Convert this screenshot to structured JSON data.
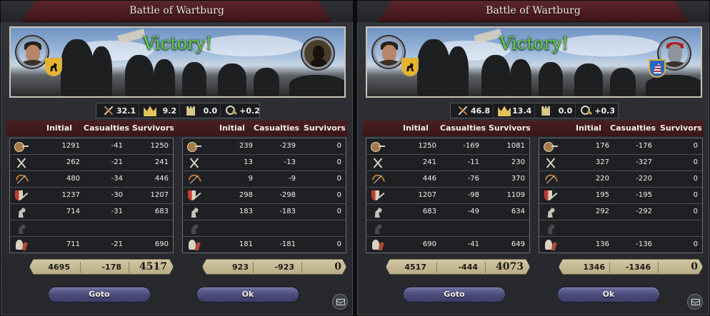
{
  "panels": [
    {
      "title": "Battle of Wartburg",
      "result": "Victory!",
      "left_commander": {
        "portrait": "bearded-noble-portrait",
        "coat_of_arms": "black-beast-on-gold-coa"
      },
      "right_commander": {
        "portrait": "unknown-silhouette-portrait"
      },
      "stats": [
        {
          "icon": "crossed-swords-icon",
          "value": "32.1"
        },
        {
          "icon": "crown-icon",
          "value": "9.2"
        },
        {
          "icon": "tower-icon",
          "value": "0.0"
        },
        {
          "icon": "magnifier-icon",
          "value": "+0.2"
        }
      ],
      "headers": [
        "Initial",
        "Casualties",
        "Survivors"
      ],
      "left_table": {
        "rows": [
          {
            "icon": "light-infantry-icon",
            "initial": "1291",
            "casualties": "-41",
            "survivors": "1250"
          },
          {
            "icon": "pikemen-icon",
            "initial": "262",
            "casualties": "-21",
            "survivors": "241"
          },
          {
            "icon": "archers-icon",
            "initial": "480",
            "casualties": "-34",
            "survivors": "446"
          },
          {
            "icon": "heavy-infantry-icon",
            "initial": "1237",
            "casualties": "-30",
            "survivors": "1207"
          },
          {
            "icon": "light-cavalry-icon",
            "initial": "714",
            "casualties": "-31",
            "survivors": "683"
          },
          {
            "icon": "horse-archers-icon",
            "initial": "",
            "casualties": "",
            "survivors": ""
          },
          {
            "icon": "knights-icon",
            "initial": "711",
            "casualties": "-21",
            "survivors": "690"
          }
        ],
        "totals": {
          "initial": "4695",
          "casualties": "-178",
          "survivors": "4517"
        }
      },
      "right_table": {
        "rows": [
          {
            "icon": "light-infantry-icon",
            "initial": "239",
            "casualties": "-239",
            "survivors": "0"
          },
          {
            "icon": "pikemen-icon",
            "initial": "13",
            "casualties": "-13",
            "survivors": "0"
          },
          {
            "icon": "archers-icon",
            "initial": "9",
            "casualties": "-9",
            "survivors": "0"
          },
          {
            "icon": "heavy-infantry-icon",
            "initial": "298",
            "casualties": "-298",
            "survivors": "0"
          },
          {
            "icon": "light-cavalry-icon",
            "initial": "183",
            "casualties": "-183",
            "survivors": "0"
          },
          {
            "icon": "horse-archers-icon",
            "initial": "",
            "casualties": "",
            "survivors": ""
          },
          {
            "icon": "knights-icon",
            "initial": "181",
            "casualties": "-181",
            "survivors": "0"
          }
        ],
        "totals": {
          "initial": "923",
          "casualties": "-923",
          "survivors": "0"
        }
      },
      "goto_label": "Goto",
      "ok_label": "Ok"
    },
    {
      "title": "Battle of Wartburg",
      "result": "Victory!",
      "left_commander": {
        "portrait": "bearded-noble-portrait",
        "coat_of_arms": "black-beast-on-gold-coa"
      },
      "right_commander": {
        "portrait": "helmeted-knight-portrait",
        "coat_of_arms": "striped-lion-on-blue-coa"
      },
      "stats": [
        {
          "icon": "crossed-swords-icon",
          "value": "46.8"
        },
        {
          "icon": "crown-icon",
          "value": "13.4"
        },
        {
          "icon": "tower-icon",
          "value": "0.0"
        },
        {
          "icon": "magnifier-icon",
          "value": "+0.3"
        }
      ],
      "headers": [
        "Initial",
        "Casualties",
        "Survivors"
      ],
      "left_table": {
        "rows": [
          {
            "icon": "light-infantry-icon",
            "initial": "1250",
            "casualties": "-169",
            "survivors": "1081"
          },
          {
            "icon": "pikemen-icon",
            "initial": "241",
            "casualties": "-11",
            "survivors": "230"
          },
          {
            "icon": "archers-icon",
            "initial": "446",
            "casualties": "-76",
            "survivors": "370"
          },
          {
            "icon": "heavy-infantry-icon",
            "initial": "1207",
            "casualties": "-98",
            "survivors": "1109"
          },
          {
            "icon": "light-cavalry-icon",
            "initial": "683",
            "casualties": "-49",
            "survivors": "634"
          },
          {
            "icon": "horse-archers-icon",
            "initial": "",
            "casualties": "",
            "survivors": ""
          },
          {
            "icon": "knights-icon",
            "initial": "690",
            "casualties": "-41",
            "survivors": "649"
          }
        ],
        "totals": {
          "initial": "4517",
          "casualties": "-444",
          "survivors": "4073"
        }
      },
      "right_table": {
        "rows": [
          {
            "icon": "light-infantry-icon",
            "initial": "176",
            "casualties": "-176",
            "survivors": "0"
          },
          {
            "icon": "pikemen-icon",
            "initial": "327",
            "casualties": "-327",
            "survivors": "0"
          },
          {
            "icon": "archers-icon",
            "initial": "220",
            "casualties": "-220",
            "survivors": "0"
          },
          {
            "icon": "heavy-infantry-icon",
            "initial": "195",
            "casualties": "-195",
            "survivors": "0"
          },
          {
            "icon": "light-cavalry-icon",
            "initial": "292",
            "casualties": "-292",
            "survivors": "0"
          },
          {
            "icon": "horse-archers-icon",
            "initial": "",
            "casualties": "",
            "survivors": ""
          },
          {
            "icon": "knights-icon",
            "initial": "136",
            "casualties": "-136",
            "survivors": "0"
          }
        ],
        "totals": {
          "initial": "1346",
          "casualties": "-1346",
          "survivors": "0"
        }
      },
      "goto_label": "Goto",
      "ok_label": "Ok"
    }
  ],
  "colors": {
    "victory_green": "#5fd04c",
    "title_bar": "#4a1c20",
    "button": "#4b4c7c",
    "total_bar": "#c8bb95"
  }
}
